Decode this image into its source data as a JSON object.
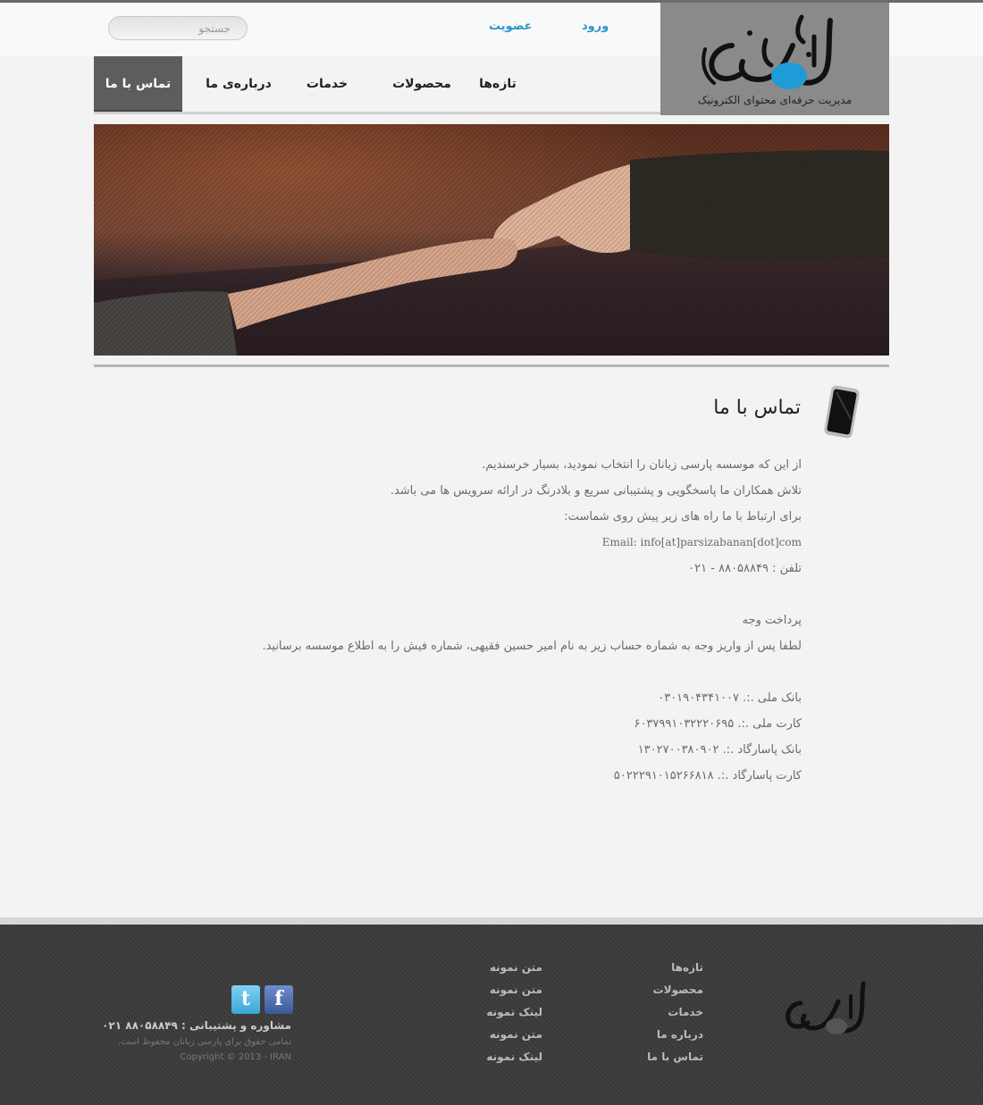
{
  "header": {
    "logo_tagline": "مدیریت حرفه‌ای محتوای الکترونیک",
    "login_label": "ورود",
    "signup_label": "عضویت",
    "search_placeholder": "جستجو"
  },
  "nav": {
    "items": [
      {
        "label": "تازه‌ها"
      },
      {
        "label": "محصولات"
      },
      {
        "label": "خدمات"
      },
      {
        "label": "درباره‌ی ما"
      },
      {
        "label": "تماس با ما",
        "active": true
      }
    ]
  },
  "main": {
    "title": "تماس با ما",
    "lines": [
      "از این که موسسه پارسی زبانان را انتخاب نمودید، بسیار خرسندیم.",
      "تلاش همکاران ما پاسخگویی و پشتیبانی سریع و بلادرنگ در ارائه سرویس ها می باشد.",
      "برای ارتباط با ما راه های زیر پیش روی شماست:",
      "Email: info[at]parsizabanan[dot]com",
      "تلفن : ۸۸۰۵۸۸۴۹ - ۰۲۱",
      "",
      "پرداخت وجه",
      "لطفا پس از واریز وجه به شماره حساب زیر به نام امیر حسین فقیهی، شماره فیش را به اطلاع موسسه برسانید.",
      "",
      "بانک ملی .:. ۰۳۰۱۹۰۴۳۴۱۰۰۷",
      "کارت ملی .:. ۶۰۳۷۹۹۱۰۳۲۲۲۰۶۹۵",
      "بانک پاسارگاد .:. ۱۳۰۲۷۰۰۳۸۰۹۰۲",
      "کارت پاسارگاد .:. ۵۰۲۲۲۹۱۰۱۵۲۶۶۸۱۸"
    ]
  },
  "footer": {
    "col1": [
      "تازه‌ها",
      "محصولات",
      "خدمات",
      "درباره ما",
      "تماس با ما"
    ],
    "col2": [
      "متن نمونه",
      "متن نمونه",
      "لینک نمونه",
      "متن نمونه",
      "لینک نمونه"
    ],
    "social": {
      "twitter": "t",
      "facebook": "f"
    },
    "support": "مشاوره و پشتیبانی : ۸۸۰۵۸۸۴۹ ۰۲۱",
    "rights": "تمامی حقوق برای پارسی زبانان محفوظ است.",
    "copyright": "Copyright © 2013 - IRAN"
  },
  "colors": {
    "accent": "#2a96c9",
    "nav_active": "#5d5d5d",
    "footer_bg": "#3b3b3b"
  },
  "icons": [
    "phone-icon",
    "twitter-icon",
    "facebook-icon"
  ]
}
